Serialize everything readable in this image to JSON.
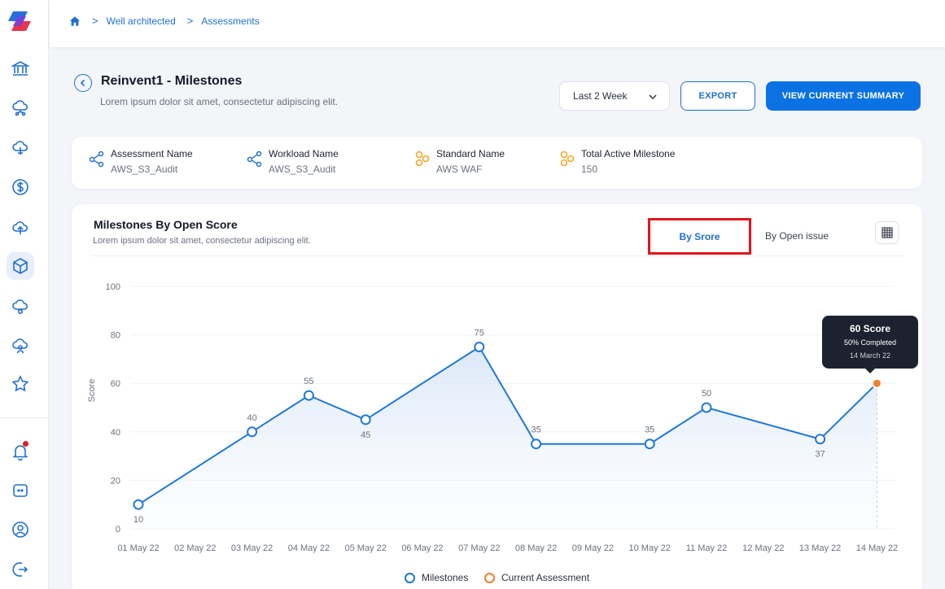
{
  "breadcrumb": [
    "Well architected",
    "Assessments"
  ],
  "header": {
    "title": "Reinvent1 - Milestones",
    "subtitle": "Lorem ipsum dolor sit amet, consectetur adipiscing elit."
  },
  "controls": {
    "period": "Last 2 Week",
    "export_label": "EXPORT",
    "summary_label": "VIEW  CURRENT SUMMARY"
  },
  "info": [
    {
      "label": "Assessment Name",
      "value": "AWS_S3_Audit",
      "icon": "share-nodes-icon"
    },
    {
      "label": "Workload Name",
      "value": "AWS_S3_Audit",
      "icon": "share-nodes-icon"
    },
    {
      "label": "Standard Name",
      "value": "AWS WAF",
      "icon": "hexagon-cluster-icon"
    },
    {
      "label": "Total Active Milestone",
      "value": "150",
      "icon": "hexagon-cluster-icon"
    }
  ],
  "chart_card": {
    "title": "Milestones By Open Score",
    "subtitle": "Lorem ipsum dolor sit amet, consectetur adipiscing elit.",
    "tab_score": "By Srore",
    "tab_issue": "By Open issue"
  },
  "tooltip": {
    "score": "60 Score",
    "completed": "50% Completed",
    "date": "14 March 22"
  },
  "legend": [
    "Milestones",
    "Current Assessment"
  ],
  "colors": {
    "primary": "#0b72e3",
    "line": "#1f78d8",
    "current": "#f07f2c",
    "highlight_border": "#e0141e",
    "tooltip_bg": "#1d2230"
  },
  "chart_data": {
    "type": "line",
    "categories": [
      "01 May 22",
      "02 May 22",
      "03 May 22",
      "04 May 22",
      "05 May 22",
      "06 May 22",
      "07 May 22",
      "08 May 22",
      "09 May 22",
      "10 May 22",
      "11 May 22",
      "12 May 22",
      "13 May 22",
      "14 May 22"
    ],
    "series": [
      {
        "name": "Milestones",
        "points": [
          {
            "x": "01 May 22",
            "y": 10,
            "label": "10"
          },
          {
            "x": "03 May 22",
            "y": 40,
            "label": "40"
          },
          {
            "x": "04 May 22",
            "y": 55,
            "label": "55"
          },
          {
            "x": "05 May 22",
            "y": 45,
            "label": "45"
          },
          {
            "x": "07 May 22",
            "y": 75,
            "label": "75"
          },
          {
            "x": "08 May 22",
            "y": 35,
            "label": "35"
          },
          {
            "x": "10 May 22",
            "y": 35,
            "label": "35"
          },
          {
            "x": "11 May 22",
            "y": 50,
            "label": "50"
          },
          {
            "x": "13 May 22",
            "y": 37,
            "label": "37"
          }
        ]
      },
      {
        "name": "Current Assessment",
        "points": [
          {
            "x": "14 May 22",
            "y": 60
          }
        ]
      }
    ],
    "ylabel": "Score",
    "yticks": [
      0,
      20,
      40,
      60,
      80,
      100
    ],
    "ylim": [
      0,
      100
    ],
    "grid": true,
    "legend_position": "bottom"
  }
}
